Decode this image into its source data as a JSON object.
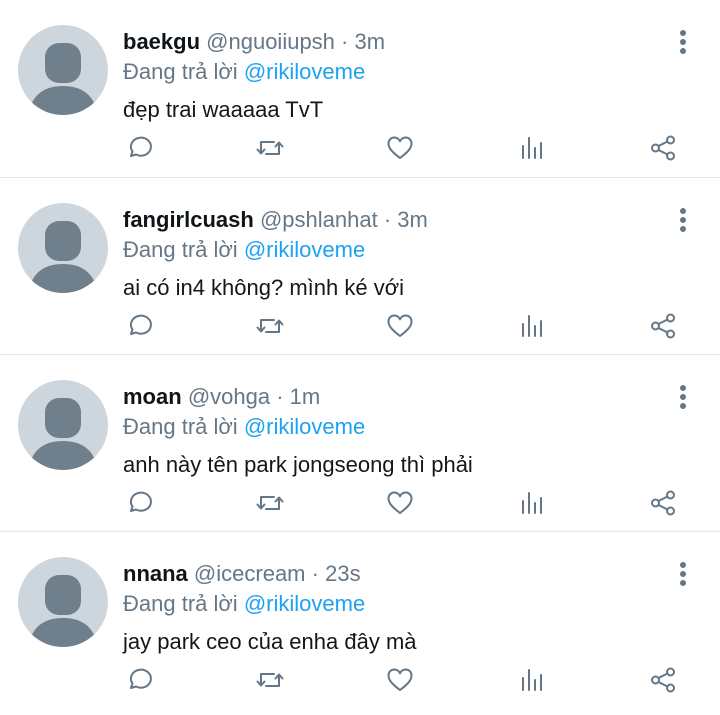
{
  "reply_prefix": "Đang trả lời",
  "colors": {
    "accent": "#1da1f2",
    "muted": "#657786",
    "text": "#14171a",
    "avatar_bg": "#cdd6dd",
    "avatar_fg": "#6f7f8c"
  },
  "icons": [
    "more-vertical-icon",
    "reply-icon",
    "retweet-icon",
    "like-icon",
    "stats-icon",
    "share-icon",
    "default-avatar-icon"
  ],
  "tweets": [
    {
      "name": "baekgu",
      "handle": "@nguoiiupsh",
      "sep": "·",
      "time": "3m",
      "reply_to": "@rikiloveme",
      "text": "đẹp trai waaaaa TvT"
    },
    {
      "name": "fangirlcuash",
      "handle": "@pshlanhat",
      "sep": "·",
      "time": "3m",
      "reply_to": "@rikiloveme",
      "text": "ai có in4 không? mình ké với"
    },
    {
      "name": "moan",
      "handle": "@vohga",
      "sep": "·",
      "time": "1m",
      "reply_to": "@rikiloveme",
      "text": "anh này tên park jongseong thì phải"
    },
    {
      "name": "nnana",
      "handle": "@icecream",
      "sep": "·",
      "time": "23s",
      "reply_to": "@rikiloveme",
      "text": "jay park ceo của enha đây mà"
    }
  ]
}
